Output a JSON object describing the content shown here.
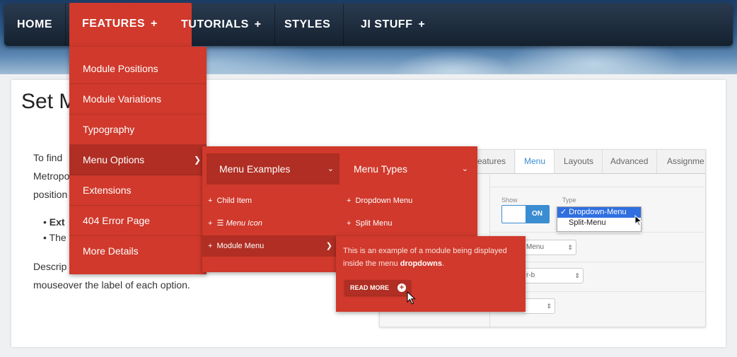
{
  "nav": {
    "items": [
      {
        "label": "HOME",
        "plus": ""
      },
      {
        "label": "FEATURES",
        "plus": "+"
      },
      {
        "label": "TUTORIALS",
        "plus": "+"
      },
      {
        "label": "STYLES",
        "plus": ""
      },
      {
        "label": "JI STUFF",
        "plus": "+"
      }
    ]
  },
  "features_menu": {
    "items": [
      "Module Positions",
      "Module Variations",
      "Typography",
      "Menu Options",
      "Extensions",
      "404 Error Page",
      "More Details"
    ]
  },
  "menu_options": {
    "col1": {
      "title": "Menu Examples",
      "items": [
        "Child Item",
        "Menu Icon",
        "Module Menu"
      ]
    },
    "col2": {
      "title": "Menu Types",
      "items": [
        "Dropdown Menu",
        "Split Menu"
      ]
    }
  },
  "module_menu": {
    "text_pre": "This is an example of a module being displayed inside the menu ",
    "text_bold": "dropdowns",
    "text_post": ".",
    "button": "READ MORE"
  },
  "page": {
    "title": "Set M",
    "para1": [
      "To find",
      "Metropo",
      "position"
    ],
    "bullets": [
      "Ext",
      "The"
    ],
    "para2": [
      "Descrip",
      "mouseover the label of each option."
    ]
  },
  "settings": {
    "tabs": [
      "eatures",
      "Menu",
      "Layouts",
      "Advanced",
      "Assignme"
    ],
    "show_label": "Show",
    "type_label": "Type",
    "toggle_on": "ON",
    "dropdown_options": [
      "✓ Dropdown-Menu",
      "Split-Menu"
    ],
    "select1": "Menu",
    "select2": "r-b",
    "select3": ""
  },
  "colors": {
    "menu_red": "#d0392c",
    "menu_dark": "#b02e23",
    "accent_blue": "#3a8dd0"
  }
}
